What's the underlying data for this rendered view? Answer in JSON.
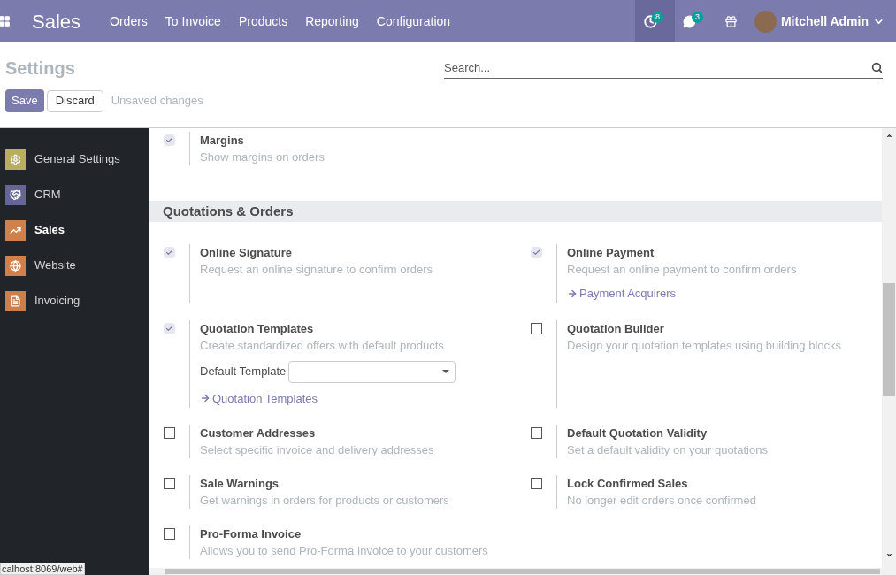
{
  "navbar": {
    "app_title": "Sales",
    "menu": [
      "Orders",
      "To Invoice",
      "Products",
      "Reporting",
      "Configuration"
    ],
    "activity_count": "8",
    "messages_count": "3",
    "user": "Mitchell Admin"
  },
  "control_panel": {
    "title": "Settings",
    "search": {
      "placeholder": "Search..."
    },
    "save": "Save",
    "discard": "Discard",
    "status": "Unsaved changes"
  },
  "sidebar": {
    "items": [
      {
        "label": "General Settings",
        "kind": "gear",
        "color": "#b8ae62",
        "selected": false
      },
      {
        "label": "CRM",
        "kind": "handshake",
        "color": "#65659a",
        "selected": false
      },
      {
        "label": "Sales",
        "kind": "chart",
        "color": "#d0804a",
        "selected": true
      },
      {
        "label": "Website",
        "kind": "globe",
        "color": "#d0804a",
        "selected": false
      },
      {
        "label": "Invoicing",
        "kind": "invoice",
        "color": "#cb7f4c",
        "selected": false
      }
    ]
  },
  "blocks": [
    {
      "settings": [
        [
          {
            "title": "Margins",
            "description": "Show margins on orders",
            "checked": true
          }
        ]
      ]
    },
    {
      "header": "Quotations & Orders",
      "settings": [
        [
          {
            "title": "Online Signature",
            "description": "Request an online signature to confirm orders",
            "checked": true
          },
          {
            "title": "Online Payment",
            "description": "Request an online payment to confirm orders",
            "checked": true,
            "link": "Payment Acquirers"
          }
        ],
        [
          {
            "title": "Quotation Templates",
            "description": "Create standardized offers with default products",
            "checked": true,
            "field_label": "Default Template",
            "link": "Quotation Templates"
          },
          {
            "title": "Quotation Builder",
            "description": "Design your quotation templates using building blocks",
            "checked": false
          }
        ],
        [
          {
            "title": "Customer Addresses",
            "description": "Select specific invoice and delivery addresses",
            "checked": false
          },
          {
            "title": "Default Quotation Validity",
            "description": "Set a default validity on your quotations",
            "checked": false
          }
        ],
        [
          {
            "title": "Sale Warnings",
            "description": "Get warnings in orders for products or customers",
            "checked": false
          },
          {
            "title": "Lock Confirmed Sales",
            "description": "No longer edit orders once confirmed",
            "checked": false
          }
        ],
        [
          {
            "title": "Pro-Forma Invoice",
            "description": "Allows you to send Pro-Forma Invoice to your customers",
            "checked": false
          }
        ]
      ]
    }
  ],
  "status_url": "calhost:8069/web#"
}
